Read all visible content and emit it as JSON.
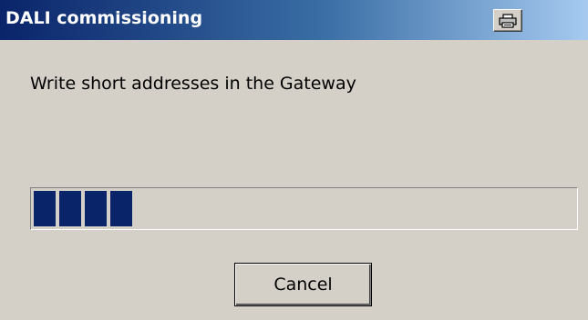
{
  "window": {
    "title": "DALI commissioning",
    "title_button_icon": "printer-icon"
  },
  "dialog": {
    "message": "Write short addresses in the Gateway",
    "progress": {
      "filled_blocks": 4,
      "fraction": 0.18
    },
    "cancel_label": "Cancel"
  },
  "colors": {
    "titlebar_start": "#0a246a",
    "titlebar_end": "#a6caf0",
    "progress_fill": "#0a246a",
    "dialog_background": "#d4d0c8"
  }
}
